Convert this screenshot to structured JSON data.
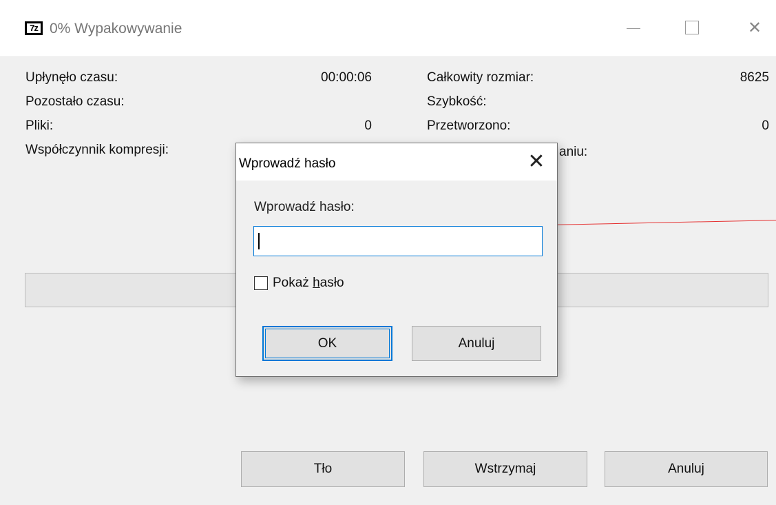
{
  "window": {
    "icon_text": "7z",
    "title": "0% Wypakowywanie",
    "minimize_glyph": "—",
    "close_glyph": "✕"
  },
  "stats": {
    "elapsed_label": "Upłynęło czasu:",
    "elapsed_value": "00:00:06",
    "remaining_label": "Pozostało czasu:",
    "remaining_value": "",
    "files_label": "Pliki:",
    "files_value": "0",
    "ratio_label": "Współczynnik kompresji:",
    "total_size_label": "Całkowity rozmiar:",
    "total_size_value": "8625",
    "speed_label": "Szybkość:",
    "speed_value": "",
    "processed_label": "Przetworzono:",
    "processed_value": "0",
    "partial_hidden_label": "aniu:"
  },
  "progress": {
    "percent": 0
  },
  "buttons": {
    "background": "Tło",
    "pause": "Wstrzymaj",
    "cancel": "Anuluj"
  },
  "dialog": {
    "title": "Wprowadź hasło",
    "close_glyph": "✕",
    "prompt": "Wprowadź hasło:",
    "password_value": "",
    "show_password_pre": "Pokaż ",
    "show_password_accel": "h",
    "show_password_post": "asło",
    "show_password_checked": false,
    "ok": "OK",
    "cancel": "Anuluj"
  },
  "colors": {
    "focus_accent": "#0078d7",
    "annotation": "#e53030"
  },
  "icons": [
    "7zip-logo-icon",
    "minimize-icon",
    "maximize-icon",
    "close-icon",
    "dialog-close-icon"
  ]
}
